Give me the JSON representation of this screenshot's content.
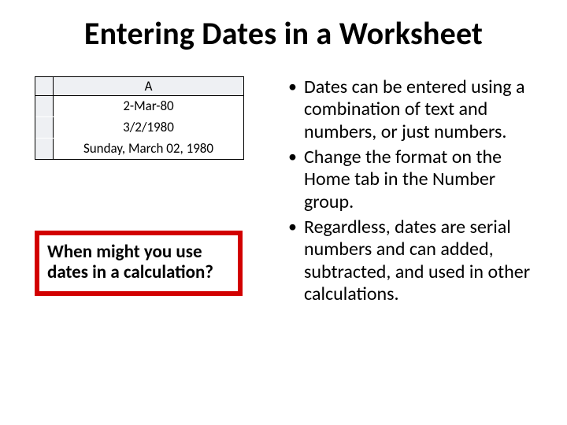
{
  "title": "Entering Dates in a Worksheet",
  "sheet": {
    "column_label": "A",
    "rows": [
      "2-Mar-80",
      "3/2/1980",
      "Sunday, March 02, 1980"
    ]
  },
  "callout": "When might you use dates in a calculation?",
  "bullets": [
    "Dates can be entered using a combination of text and numbers, or just numbers.",
    "Change the format on the Home tab in the Number group.",
    "Regardless, dates are serial numbers and can added, subtracted, and used in other calculations."
  ]
}
